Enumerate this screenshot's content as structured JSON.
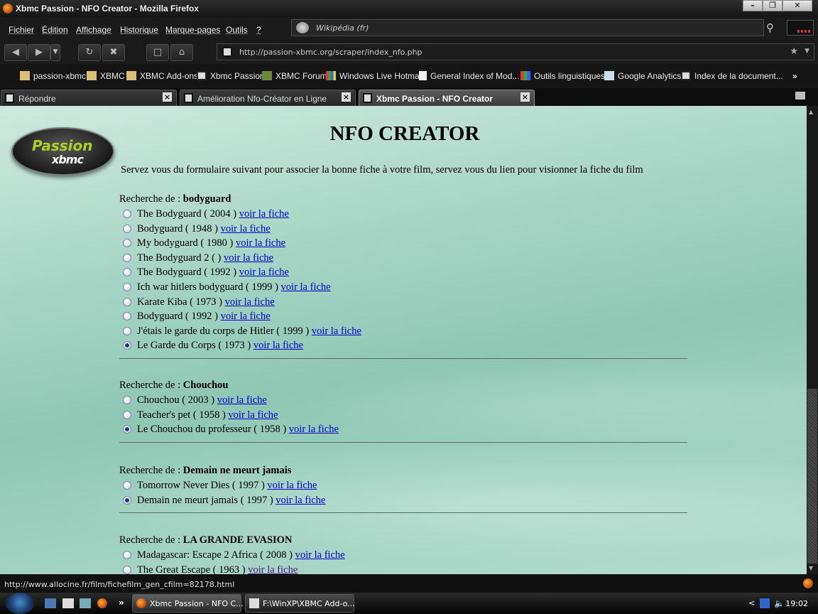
{
  "window": {
    "title": "Xbmc Passion - NFO Creator - Mozilla Firefox"
  },
  "menu": [
    "Fichier",
    "Édition",
    "Affichage",
    "Historique",
    "Marque-pages",
    "Outils",
    "?"
  ],
  "search": {
    "engine": "Wikipédia (fr)"
  },
  "address": {
    "url": "http://passion-xbmc.org/scraper/index_nfo.php"
  },
  "bookmarks": [
    "passion-xbmc",
    "XBMC",
    "XBMC Add-ons",
    "Xbmc Passion",
    "XBMC Forum",
    "Windows Live Hotmail",
    "General Index of Mod...",
    "Outils linguistiques",
    "Google Analytics",
    "Index de la document..."
  ],
  "tabs": [
    {
      "label": "Répondre"
    },
    {
      "label": "Amélioration Nfo-Créator en Ligne"
    },
    {
      "label": "Xbmc Passion - NFO Creator"
    }
  ],
  "page": {
    "logo_top": "Passion",
    "logo_bottom": "xbmc",
    "title": "NFO CREATOR",
    "intro": "Servez vous du formulaire suivant pour associer la bonne fiche à votre film, servez vous du lien pour visionner la fiche du film",
    "search_prefix": "Recherche de : ",
    "link_label": "voir la fiche",
    "sections": [
      {
        "query": "bodyguard",
        "options": [
          {
            "text": "The Bodyguard ( 2004 )",
            "checked": false
          },
          {
            "text": "Bodyguard ( 1948 )",
            "checked": false
          },
          {
            "text": "My bodyguard ( 1980 )",
            "checked": false
          },
          {
            "text": "The Bodyguard 2 ( )",
            "checked": false
          },
          {
            "text": "The Bodyguard ( 1992 )",
            "checked": false
          },
          {
            "text": "Ich war hitlers bodyguard ( 1999 )",
            "checked": false
          },
          {
            "text": "Karate Kiba ( 1973 )",
            "checked": false
          },
          {
            "text": "Bodyguard ( 1992 )",
            "checked": false
          },
          {
            "text": "J'étais le garde du corps de Hitler ( 1999 )",
            "checked": false
          },
          {
            "text": "Le Garde du Corps ( 1973 )",
            "checked": true
          }
        ]
      },
      {
        "query": "Chouchou",
        "options": [
          {
            "text": "Chouchou ( 2003 )",
            "checked": false
          },
          {
            "text": "Teacher's pet ( 1958 )",
            "checked": false
          },
          {
            "text": "Le Chouchou du professeur ( 1958 )",
            "checked": true
          }
        ]
      },
      {
        "query": "Demain ne meurt jamais",
        "options": [
          {
            "text": "Tomorrow Never Dies ( 1997 )",
            "checked": false
          },
          {
            "text": "Demain ne meurt jamais ( 1997 )",
            "checked": true
          }
        ]
      },
      {
        "query": "LA GRANDE EVASION",
        "options": [
          {
            "text": "Madagascar: Escape 2 Africa ( 2008 )",
            "checked": false
          },
          {
            "text": "The Great Escape ( 1963 )",
            "checked": false
          }
        ]
      }
    ]
  },
  "status": {
    "text": "http://www.allocine.fr/film/fichefilm_gen_cfilm=82178.html"
  },
  "taskbar": {
    "buttons": [
      "Xbmc Passion - NFO C...",
      "F:\\WinXP\\XBMC Add-o..."
    ],
    "clock": "19:02"
  }
}
